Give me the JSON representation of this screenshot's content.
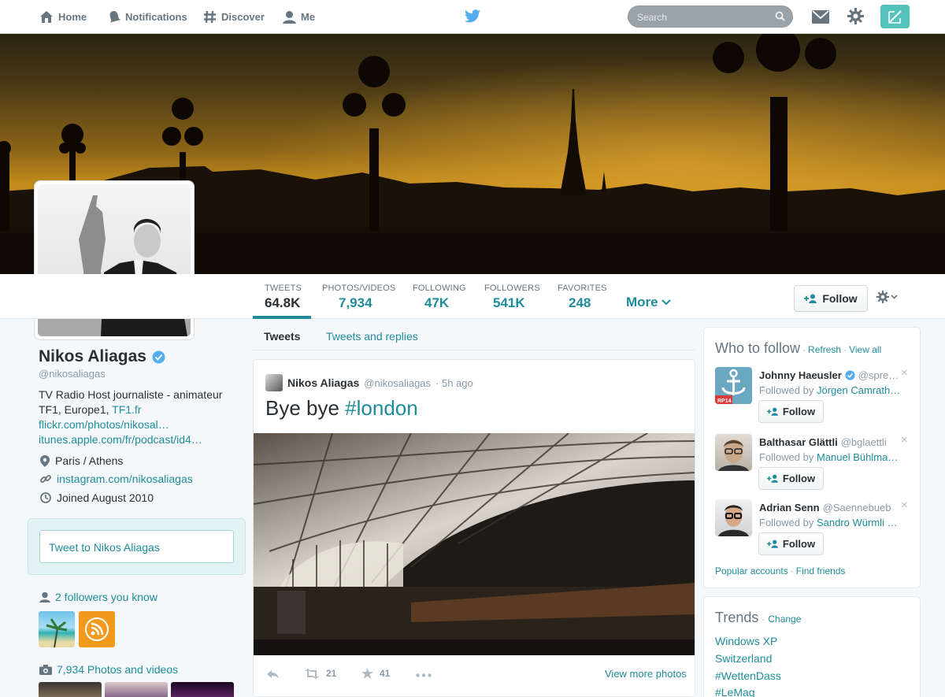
{
  "nav": {
    "home": "Home",
    "notifications": "Notifications",
    "discover": "Discover",
    "me": "Me",
    "search_placeholder": "Search"
  },
  "profile": {
    "name": "Nikos Aliagas",
    "handle": "@nikosaliagas",
    "bio_line1": "TV Radio Host journaliste - animateur",
    "bio_line2_prefix": "TF1, Europe1, ",
    "bio_line2_link": "TF1.fr",
    "bio_link1": "flickr.com/photos/nikosal…",
    "bio_link2": "itunes.apple.com/fr/podcast/id4…",
    "location": "Paris / Athens",
    "website": "instagram.com/nikosaliagas",
    "joined": "Joined August 2010",
    "tweet_to": "Tweet to Nikos Aliagas",
    "followers_you_know": "2 followers you know",
    "photos_videos": "7,934 Photos and videos"
  },
  "stats": [
    {
      "label": "TWEETS",
      "value": "64.8K"
    },
    {
      "label": "PHOTOS/VIDEOS",
      "value": "7,934"
    },
    {
      "label": "FOLLOWING",
      "value": "47K"
    },
    {
      "label": "FOLLOWERS",
      "value": "541K"
    },
    {
      "label": "FAVORITES",
      "value": "248"
    }
  ],
  "more_label": "More",
  "follow_label": "Follow",
  "tabs": {
    "tweets": "Tweets",
    "replies": "Tweets and replies"
  },
  "tweet": {
    "author": "Nikos Aliagas",
    "handle": "@nikosaliagas",
    "time": "· 5h ago",
    "text_prefix": "Bye bye ",
    "hashtag": "#london",
    "retweets": "21",
    "favorites": "41",
    "view_more": "View more photos"
  },
  "who_to_follow": {
    "title": "Who to follow",
    "refresh": "Refresh",
    "view_all": "View all",
    "suggestions": [
      {
        "name": "Johnny Haeusler",
        "handle": "@spre…",
        "followed_by_prefix": "Followed by ",
        "followed_by": "Jörgen Camrath…",
        "follow": "Follow",
        "close": "×"
      },
      {
        "name": "Balthasar Glättli",
        "handle": "@bglaettli",
        "followed_by_prefix": "Followed by ",
        "followed_by": "Manuel Bühlma…",
        "follow": "Follow",
        "close": "×"
      },
      {
        "name": "Adrian Senn",
        "handle": "@Saennebueb",
        "followed_by_prefix": "Followed by ",
        "followed_by": "Sandro Würmli …",
        "follow": "Follow",
        "close": "×"
      }
    ],
    "popular": "Popular accounts",
    "find_friends": "Find friends",
    "separator": "·"
  },
  "trends": {
    "title": "Trends",
    "change": "Change",
    "items": [
      "Windows XP",
      "Switzerland",
      "#WettenDass",
      "#LeMag"
    ]
  },
  "badge_text": "RP14",
  "colors": {
    "accent": "#1e8c9a",
    "compose": "#52c2bb",
    "twitter_blue": "#55acee"
  }
}
